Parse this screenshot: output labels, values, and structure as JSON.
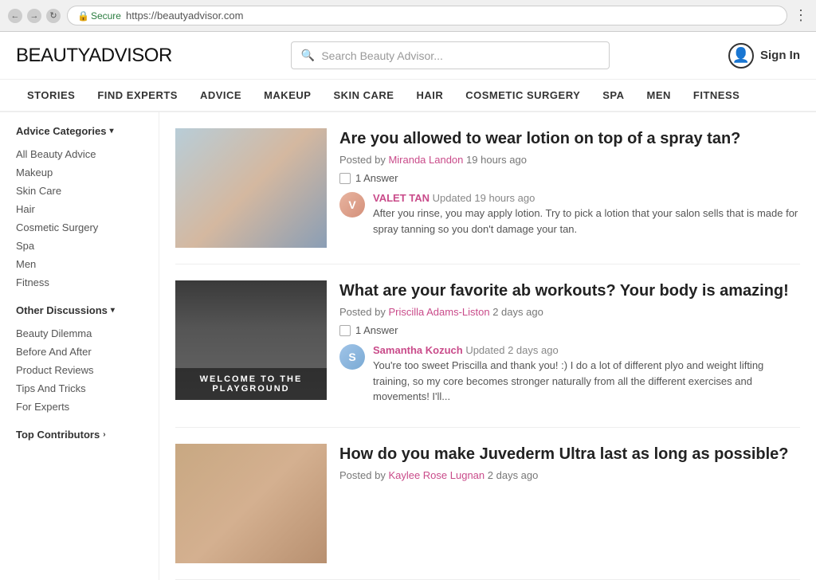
{
  "browser": {
    "url": "https://beautyadvisor.com",
    "secure_label": "Secure",
    "url_display": "https://beautyadvisor.com"
  },
  "header": {
    "logo_bold": "BEAUTY",
    "logo_light": "ADVISOR",
    "search_placeholder": "Search Beauty Advisor...",
    "sign_in_label": "Sign In"
  },
  "nav": {
    "items": [
      {
        "label": "STORIES"
      },
      {
        "label": "FIND EXPERTS"
      },
      {
        "label": "ADVICE"
      },
      {
        "label": "MAKEUP"
      },
      {
        "label": "SKIN CARE"
      },
      {
        "label": "HAIR"
      },
      {
        "label": "COSMETIC SURGERY"
      },
      {
        "label": "SPA"
      },
      {
        "label": "MEN"
      },
      {
        "label": "FITNESS"
      }
    ]
  },
  "sidebar": {
    "advice_categories_label": "Advice Categories",
    "advice_items": [
      "All Beauty Advice",
      "Makeup",
      "Skin Care",
      "Hair",
      "Cosmetic Surgery",
      "Spa",
      "Men",
      "Fitness"
    ],
    "other_discussions_label": "Other Discussions",
    "other_items": [
      "Beauty Dilemma",
      "Before And After",
      "Product Reviews",
      "Tips And Tricks",
      "For Experts"
    ],
    "top_contributors_label": "Top Contributors"
  },
  "posts": [
    {
      "title": "Are you allowed to wear lotion on top of a spray tan?",
      "posted_by": "Miranda Landon",
      "time_ago": "19 hours ago",
      "answer_count": "1 Answer",
      "reply": {
        "name": "VALET TAN",
        "time": "Updated 19 hours ago",
        "text": "After you rinse, you may apply lotion. Try to pick a lotion that your salon sells that is made for spray tanning so you don't damage your tan.",
        "avatar_letter": "V",
        "avatar_class": "reply-avatar"
      }
    },
    {
      "title": "What are your favorite ab workouts? Your body is amazing!",
      "posted_by": "Priscilla Adams-Liston",
      "time_ago": "2 days ago",
      "answer_count": "1 Answer",
      "image_overlay": "WELCOME TO THE PLAYGROUND",
      "reply": {
        "name": "Samantha Kozuch",
        "time": "Updated 2 days ago",
        "text": "You're too sweet Priscilla and thank you! :) I do a lot of different plyo and weight lifting training, so my core becomes stronger naturally from all the different exercises and movements! I'll...",
        "avatar_letter": "S",
        "avatar_class": "reply-avatar reply-avatar-2"
      }
    },
    {
      "title": "How do you make Juvederm Ultra last as long as possible?",
      "posted_by": "Kaylee Rose Lugnan",
      "time_ago": "2 days ago",
      "answer_count": "",
      "reply": null
    }
  ]
}
